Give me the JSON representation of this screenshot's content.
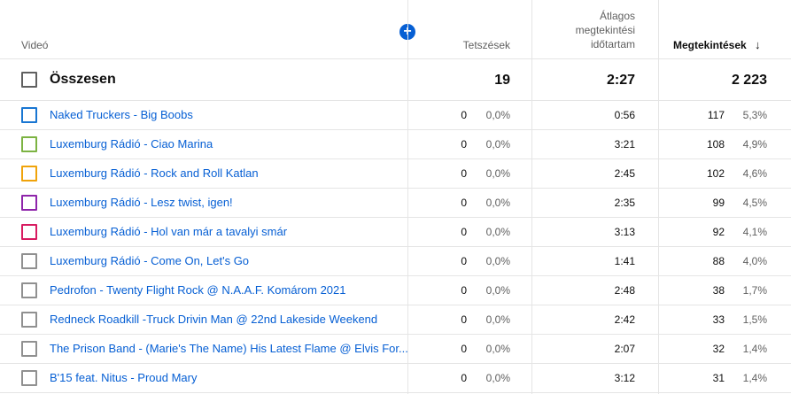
{
  "header": {
    "video": "Videó",
    "likes": "Tetszések",
    "avg_duration": [
      "Átlagos",
      "megtekintési",
      "időtartam"
    ],
    "views": "Megtekintések",
    "sort_arrow": "↓",
    "add_icon": "+"
  },
  "total": {
    "label": "Összesen",
    "likes": "19",
    "avg_duration": "2:27",
    "views": "2 223"
  },
  "rows": [
    {
      "title": "Naked Truckers - Big Boobs",
      "likes": "0",
      "likes_pct": "0,0%",
      "duration": "0:56",
      "views": "117",
      "views_pct": "5,3%",
      "color": "#1976d2"
    },
    {
      "title": "Luxemburg Rádió - Ciao Marina",
      "likes": "0",
      "likes_pct": "0,0%",
      "duration": "3:21",
      "views": "108",
      "views_pct": "4,9%",
      "color": "#7cb342"
    },
    {
      "title": "Luxemburg Rádió - Rock and Roll Katlan",
      "likes": "0",
      "likes_pct": "0,0%",
      "duration": "2:45",
      "views": "102",
      "views_pct": "4,6%",
      "color": "#f0a30a"
    },
    {
      "title": "Luxemburg Rádió - Lesz twist, igen!",
      "likes": "0",
      "likes_pct": "0,0%",
      "duration": "2:35",
      "views": "99",
      "views_pct": "4,5%",
      "color": "#8e24aa"
    },
    {
      "title": "Luxemburg Rádió - Hol van már a tavalyi smár",
      "likes": "0",
      "likes_pct": "0,0%",
      "duration": "3:13",
      "views": "92",
      "views_pct": "4,1%",
      "color": "#d81b60"
    },
    {
      "title": "Luxemburg Rádió - Come On, Let's Go",
      "likes": "0",
      "likes_pct": "0,0%",
      "duration": "1:41",
      "views": "88",
      "views_pct": "4,0%",
      "color": "#909090"
    },
    {
      "title": "Pedrofon - Twenty Flight Rock @ N.A.A.F. Komárom 2021",
      "likes": "0",
      "likes_pct": "0,0%",
      "duration": "2:48",
      "views": "38",
      "views_pct": "1,7%",
      "color": "#909090"
    },
    {
      "title": "Redneck Roadkill -Truck Drivin Man @ 22nd Lakeside Weekend",
      "likes": "0",
      "likes_pct": "0,0%",
      "duration": "2:42",
      "views": "33",
      "views_pct": "1,5%",
      "color": "#909090"
    },
    {
      "title": "The Prison Band - (Marie's The Name) His Latest Flame @ Elvis For...",
      "likes": "0",
      "likes_pct": "0,0%",
      "duration": "2:07",
      "views": "32",
      "views_pct": "1,4%",
      "color": "#909090"
    },
    {
      "title": "B'15 feat. Nitus - Proud Mary",
      "likes": "0",
      "likes_pct": "0,0%",
      "duration": "3:12",
      "views": "31",
      "views_pct": "1,4%",
      "color": "#909090"
    }
  ]
}
